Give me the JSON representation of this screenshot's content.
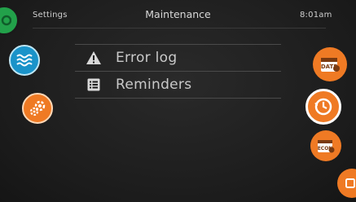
{
  "header": {
    "left_label": "Settings",
    "title": "Maintenance",
    "time": "8:01am"
  },
  "menu": {
    "items": [
      {
        "label": "Error log",
        "icon": "warning-icon"
      },
      {
        "label": "Reminders",
        "icon": "list-icon"
      }
    ]
  },
  "side_buttons": {
    "left": [
      {
        "name": "home-button",
        "icon": "power-icon",
        "color": "#22a14a"
      },
      {
        "name": "water-button",
        "icon": "water-waves-icon",
        "color": "#1a93c9"
      },
      {
        "name": "settings-button",
        "icon": "gear-icon",
        "color": "#ef7a24"
      }
    ],
    "right": [
      {
        "name": "date-button",
        "icon": "calendar-icon",
        "color": "#ef7a24",
        "text": "DATE"
      },
      {
        "name": "time-button",
        "icon": "clock-icon",
        "color": "#ef7a24"
      },
      {
        "name": "economy-button",
        "icon": "calendar-icon",
        "color": "#ef7a24",
        "text": "ECON"
      },
      {
        "name": "exit-button",
        "icon": "exit-icon",
        "color": "#ef7a24"
      }
    ]
  }
}
